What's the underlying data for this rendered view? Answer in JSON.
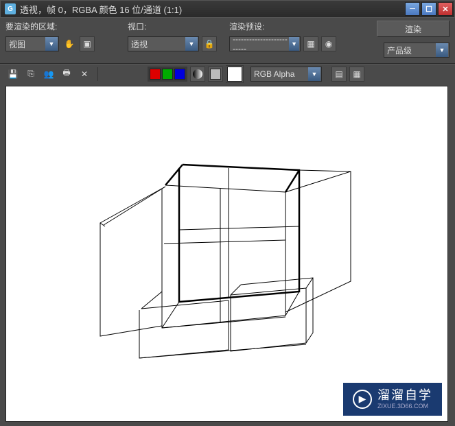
{
  "titlebar": {
    "title": "透视，帧 0，RGBA 颜色 16 位/通道 (1:1)"
  },
  "toolbar": {
    "area_label": "要渲染的区域:",
    "area_value": "视图",
    "viewport_label": "视口:",
    "viewport_value": "透视",
    "preset_label": "渲染预设:",
    "preset_value": "-------------------------",
    "quality_value": "产品级",
    "render_label": "渲染",
    "channel_label": "RGB Alpha"
  },
  "watermark": {
    "brand": "溜溜自学",
    "url": "ZIXUE.3D66.COM"
  }
}
